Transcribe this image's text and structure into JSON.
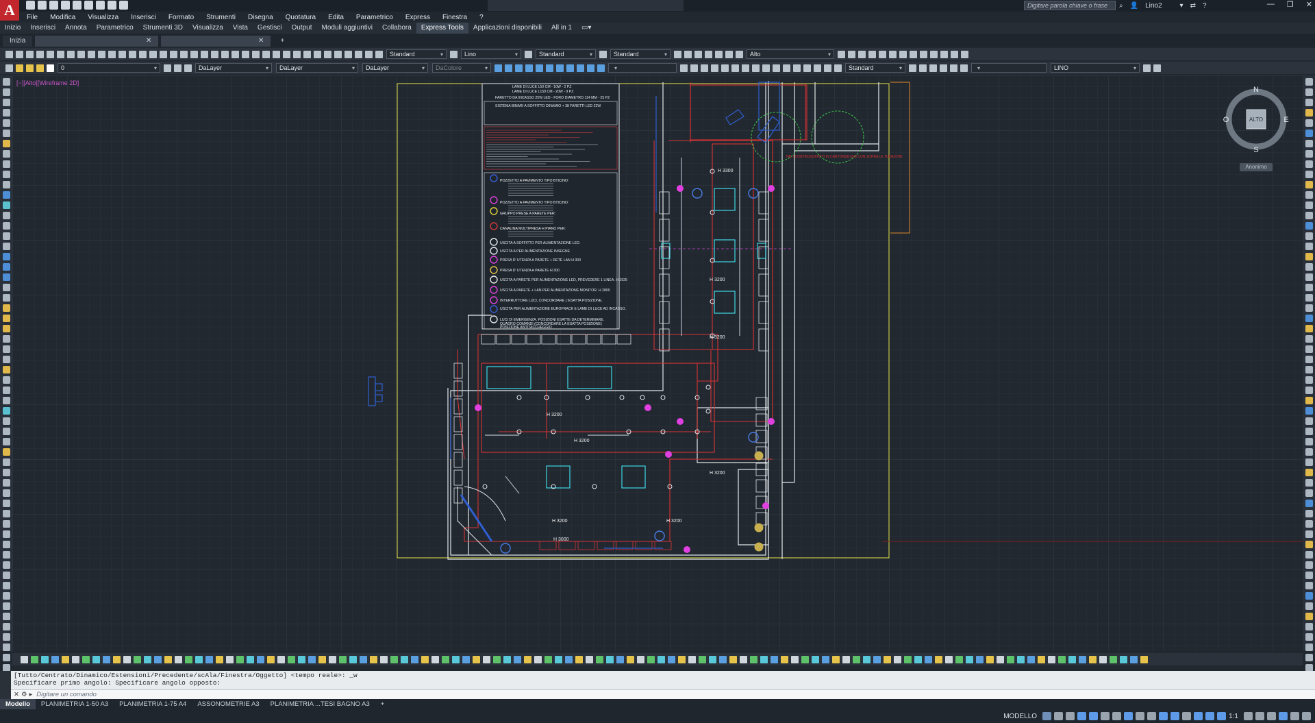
{
  "app": {
    "logo_letter": "A",
    "search_placeholder": "Digitare parola chiave o frase",
    "user": "Lino2"
  },
  "menubar": [
    "File",
    "Modifica",
    "Visualizza",
    "Inserisci",
    "Formato",
    "Strumenti",
    "Disegna",
    "Quotatura",
    "Edita",
    "Parametrico",
    "Express",
    "Finestra",
    "?"
  ],
  "ribbon_tabs": [
    "Inizio",
    "Inserisci",
    "Annota",
    "Parametrico",
    "Strumenti 3D",
    "Visualizza",
    "Vista",
    "Gestisci",
    "Output",
    "Moduli aggiuntivi",
    "Collabora",
    "Express Tools",
    "Applicazioni disponibili",
    "All in 1"
  ],
  "active_ribbon_tab": "Express Tools",
  "doc_tabs": {
    "start": "Inizia",
    "add": "+"
  },
  "toolbar1": {
    "text_style": "Standard",
    "dim_style": "Lino",
    "table_style": "Standard",
    "mleader_style": "Standard",
    "view": "Alto"
  },
  "toolbar2": {
    "layer": "0",
    "color": "DaLayer",
    "linetype": "DaLayer",
    "lineweight": "DaLayer",
    "plotstyle": "DaColore",
    "visual_style": "Standard",
    "workspace": "LINO"
  },
  "viewport_label": "[−][Alto][Wireframe 2D]",
  "viewcube": {
    "north": "N",
    "south": "S",
    "east": "E",
    "west": "O",
    "face": "ALTO",
    "ucs": "Anonimo"
  },
  "drawing": {
    "legend_lines": [
      "LAME DI LUCE L50 CM - 10W - 2 PZ",
      "LAME DI LUCE L150 CM - 20W - 9 PZ",
      "FARETTO DA INCASSO 25W LED - FORO DIAMETRO 114 MM - 25 PZ",
      "SISTEMA BINARI A SOFFITTO DINAMIO + 38 FARETTI LED 22W",
      "POZZETTO A PAVIMENTO TIPO BTICINO:",
      "POZZETTO A PAVIMENTO TIPO BTICINO:",
      "GRUPPO PRESE A PARETE PER:",
      "CANALINA MULTIPRESA H PIANO PER:",
      "USCITA A SOFFITTO PER ALIMENTAZIONE LED.",
      "USCITA A PER ALIMENTAZIONE INSEGNE",
      "PRESA D' UTENZA A PARETE + RETE LAN H 300",
      "PRESA D' UTENZA A PARETE H 300",
      "USCITA A PARETE PER ALIMENTAZIONE LED, PREVEDERE 1 LINEA. H 1925",
      "USCITA A PARETE + LAN PER ALIMENTAZIONE MONITOR. H 2800",
      "INTERRUTTORE LUCI, CONCORDARE L'ESATTA POSIZIONE.",
      "USCITA PER ALIMENTAZIONE EUROFRACK E LAME DI LUCE AD INCASSO.",
      "LUCI DI EMERGENZA. POSIZIONI ESATTE DA DETERMINARE.",
      "QUADRO COMANDI (CONCORDARE LA ESATTA POSIZIONE)",
      "POSIZIONE ANTITACCHEGGIO"
    ],
    "dims": [
      "H 3300",
      "H 3200",
      "H 3200",
      "H 3200",
      "H 3200",
      "H 3200",
      "H 3200",
      "H 3000",
      "H 3200"
    ],
    "red_note": "NB: I CONTROSOFFITTI IN CARTONGESSO CON SOPRA LE TUBAZIONI"
  },
  "command": {
    "history_1": "[Tutto/Centrato/Dinamico/Estensioni/Precedente/scAla/Finestra/Oggetto] <tempo reale>: _w",
    "history_2": "Specificare primo angolo: Specificare angolo opposto:",
    "prompt": "Digitare un comando"
  },
  "layout_tabs": [
    "Modello",
    "PLANIMETRIA 1-50 A3",
    "PLANIMETRIA 1-75 A4",
    "ASSONOMETRIE A3",
    "PLANIMETRIA ...TESI BAGNO A3",
    "+"
  ],
  "active_layout": "Modello",
  "status": {
    "space": "MODELLO",
    "scale": "1:1"
  }
}
